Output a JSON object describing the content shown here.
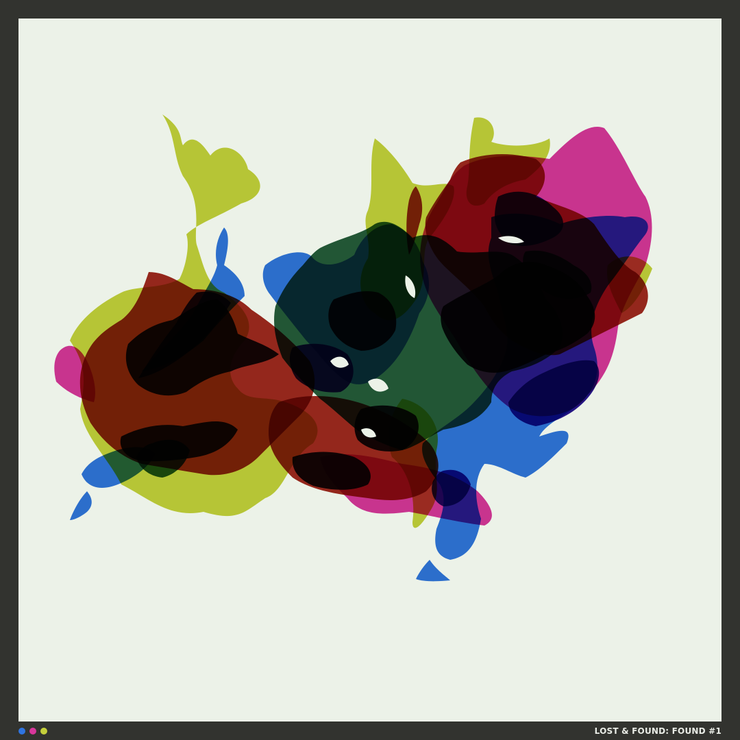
{
  "footer": {
    "title": "LOST & FOUND: FOUND #1"
  },
  "palette": {
    "frame": "#32332f",
    "background": "#ecf2e8",
    "colors": [
      "#2f74e0",
      "#d8379c",
      "#c5d03b"
    ],
    "accents": [
      "#a0291e",
      "#245a3a",
      "#1e1a22",
      "#27168f"
    ]
  },
  "swatches": [
    {
      "name": "blue",
      "color": "#2f74e0"
    },
    {
      "name": "magenta",
      "color": "#d8379c"
    },
    {
      "name": "yellow",
      "color": "#c5d03b"
    }
  ]
}
